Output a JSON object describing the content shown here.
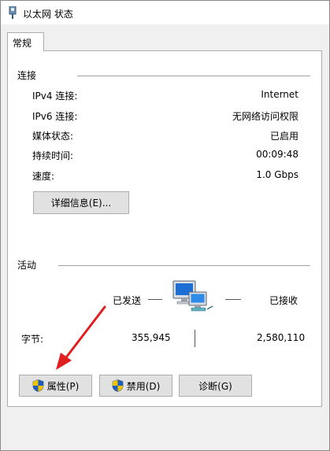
{
  "window": {
    "title": "以太网 状态",
    "title_icon": "network-adapter-icon"
  },
  "tabs": [
    {
      "label": "常规"
    }
  ],
  "connection": {
    "title": "连接",
    "rows": [
      {
        "label": "IPv4 连接:",
        "value": "Internet"
      },
      {
        "label": "IPv6 连接:",
        "value": "无网络访问权限"
      },
      {
        "label": "媒体状态:",
        "value": "已启用"
      },
      {
        "label": "持续时间:",
        "value": "00:09:48"
      },
      {
        "label": "速度:",
        "value": "1.0 Gbps"
      }
    ],
    "details_button": "详细信息(E)..."
  },
  "activity": {
    "title": "活动",
    "sent_label": "已发送",
    "received_label": "已接收",
    "bytes_label": "字节:",
    "bytes_sent": "355,945",
    "bytes_received": "2,580,110",
    "icon": "network-computers-icon"
  },
  "buttons": {
    "properties": "属性(P)",
    "disable": "禁用(D)",
    "diagnose": "诊断(G)",
    "shield_icon": "uac-shield-icon"
  },
  "colors": {
    "annotation_arrow": "#e02020",
    "shield_blue": "#1f5fbf",
    "shield_yellow": "#f2c200"
  }
}
